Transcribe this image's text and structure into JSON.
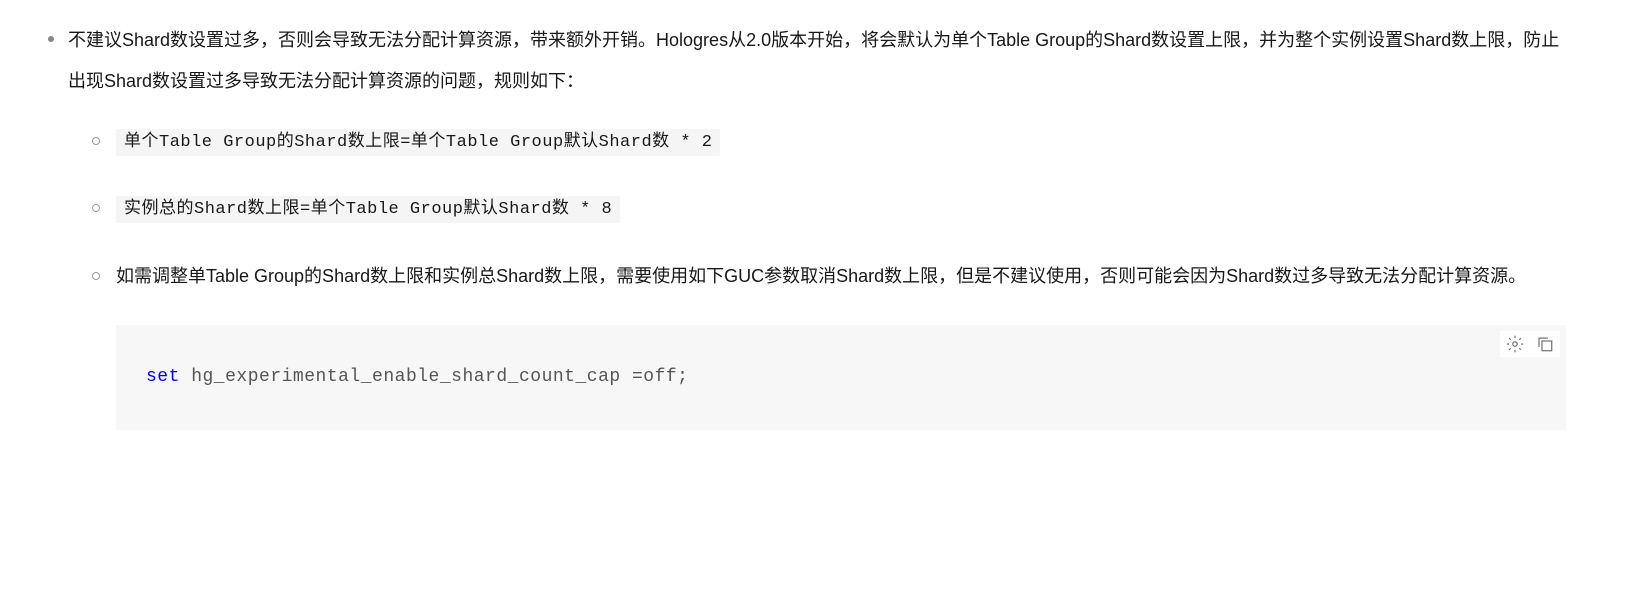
{
  "main_bullet": "不建议Shard数设置过多，否则会导致无法分配计算资源，带来额外开销。Hologres从2.0版本开始，将会默认为单个Table Group的Shard数设置上限，并为整个实例设置Shard数上限，防止出现Shard数设置过多导致无法分配计算资源的问题，规则如下：",
  "sub_bullets": {
    "item1_code": "单个Table Group的Shard数上限=单个Table Group默认Shard数 * 2",
    "item2_code": "实例总的Shard数上限=单个Table Group默认Shard数 * 8",
    "item3_text": "如需调整单Table Group的Shard数上限和实例总Shard数上限，需要使用如下GUC参数取消Shard数上限，但是不建议使用，否则可能会因为Shard数过多导致无法分配计算资源。"
  },
  "code_block": {
    "keyword": "set",
    "rest": " hg_experimental_enable_shard_count_cap =off;"
  }
}
